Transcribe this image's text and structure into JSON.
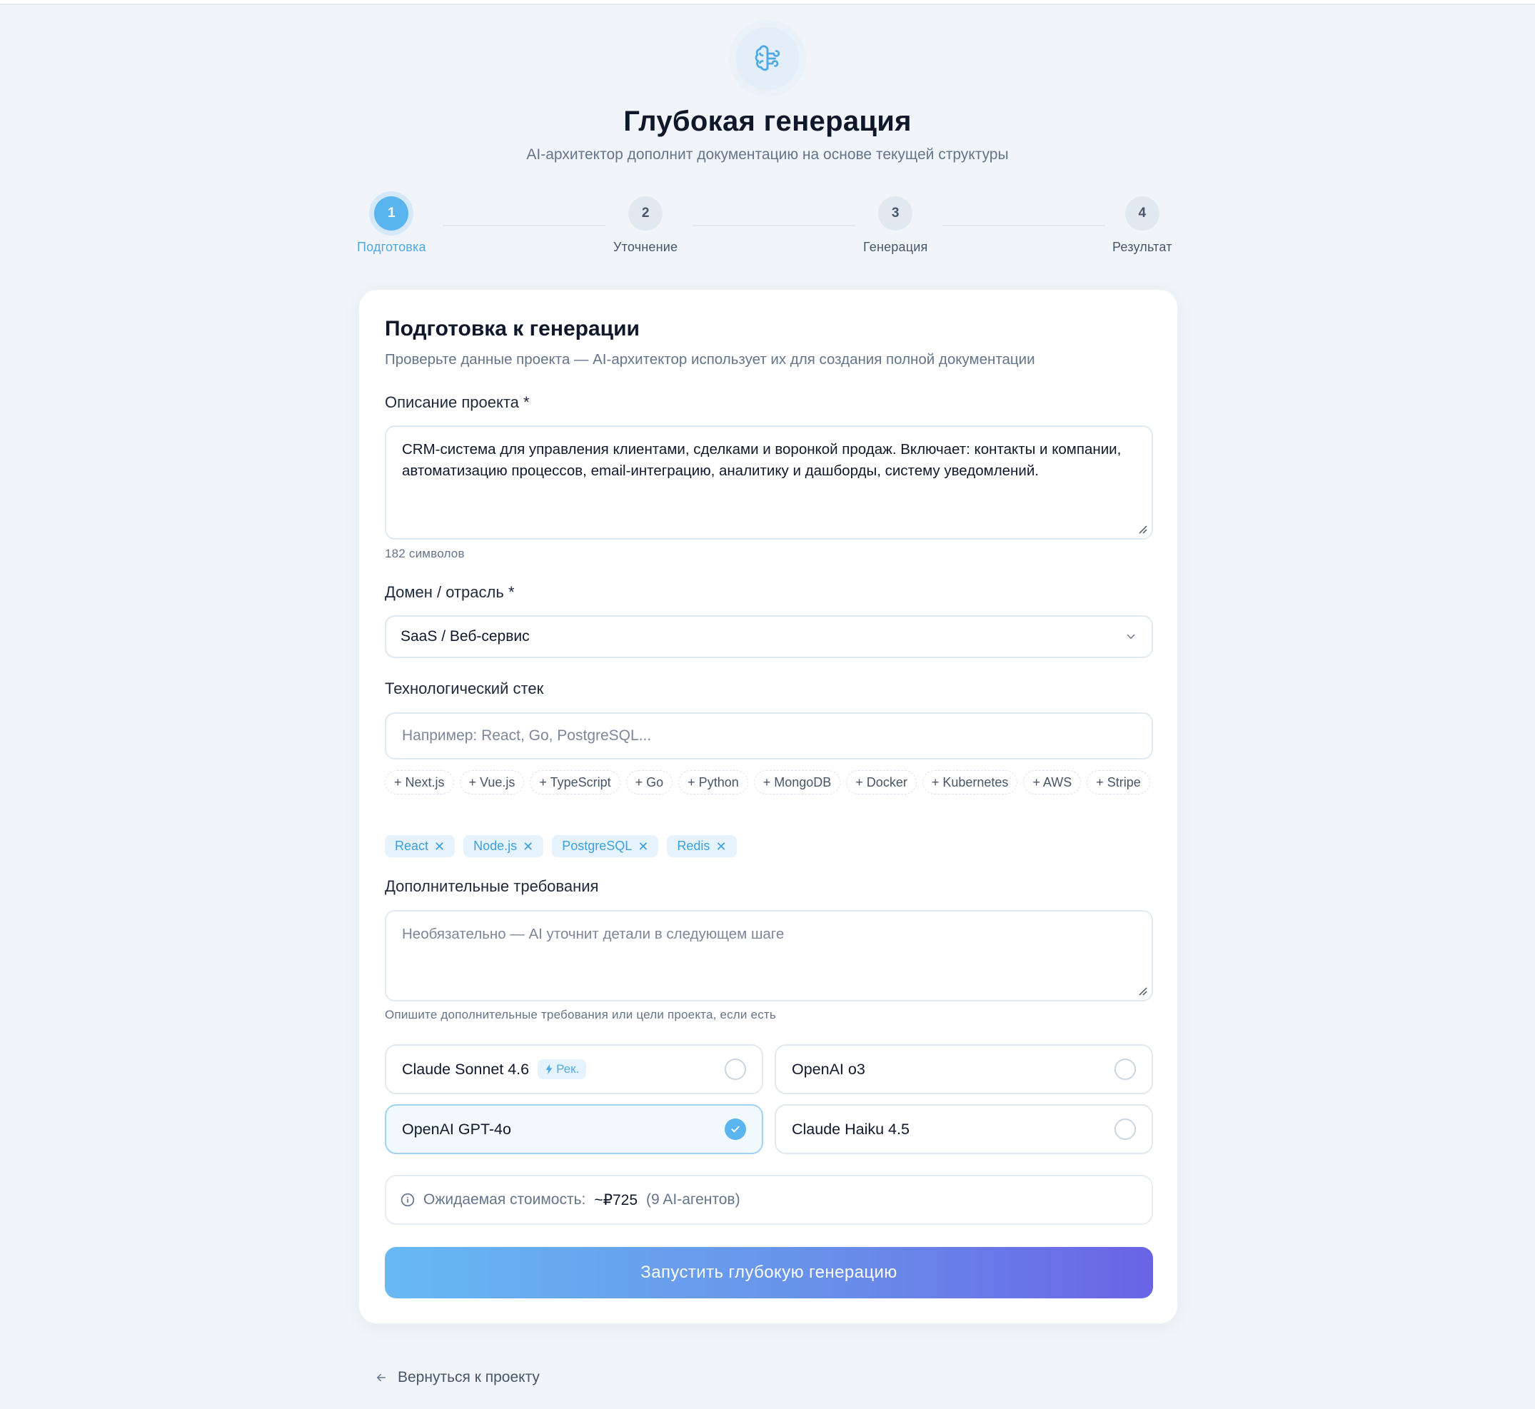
{
  "header": {
    "title": "Глубокая генерация",
    "subtitle": "AI-архитектор дополнит документацию на основе текущей структуры",
    "logo_icon": "brain-icon"
  },
  "stepper": {
    "steps": [
      {
        "number": "1",
        "label": "Подготовка",
        "active": true
      },
      {
        "number": "2",
        "label": "Уточнение",
        "active": false
      },
      {
        "number": "3",
        "label": "Генерация",
        "active": false
      },
      {
        "number": "4",
        "label": "Результат",
        "active": false
      }
    ]
  },
  "form": {
    "title": "Подготовка к генерации",
    "subtitle": "Проверьте данные проекта — AI-архитектор использует их для создания полной документации",
    "description": {
      "label": "Описание проекта *",
      "value": "CRM-система для управления клиентами, сделками и воронкой продаж. Включает: контакты и компании, автоматизацию процессов, email-интеграцию, аналитику и дашборды, систему уведомлений.",
      "char_count": "182 символов"
    },
    "domain": {
      "label": "Домен / отрасль *",
      "value": "SaaS / Веб-сервис"
    },
    "stack": {
      "label": "Технологический стек",
      "placeholder": "Например: React, Go, PostgreSQL...",
      "suggestions": [
        "+ Next.js",
        "+ Vue.js",
        "+ TypeScript",
        "+ Go",
        "+ Python",
        "+ MongoDB",
        "+ Docker",
        "+ Kubernetes",
        "+ AWS",
        "+ Stripe"
      ],
      "selected": [
        "React",
        "Node.js",
        "PostgreSQL",
        "Redis"
      ]
    },
    "requirements": {
      "label": "Дополнительные требования",
      "placeholder": "Необязательно — AI уточнит детали в следующем шаге",
      "hint": "Опишите дополнительные требования или цели проекта, если есть"
    },
    "models": [
      {
        "name": "Claude Sonnet 4.6",
        "badge": "Рек.",
        "selected": false
      },
      {
        "name": "OpenAI o3",
        "badge": "",
        "selected": false
      },
      {
        "name": "OpenAI GPT-4o",
        "badge": "",
        "selected": true
      },
      {
        "name": "Claude Haiku 4.5",
        "badge": "",
        "selected": false
      }
    ],
    "cost": {
      "prefix": "Ожидаемая стоимость:",
      "amount": "~₽725",
      "suffix": "(9 AI-агентов)"
    },
    "submit_label": "Запустить глубокую генерацию"
  },
  "back_link": "Вернуться к проекту",
  "colors": {
    "accent": "#5ab4ee",
    "gradient_start": "#67b9f3",
    "gradient_end": "#6a63e6",
    "background": "#f1f5fa"
  }
}
